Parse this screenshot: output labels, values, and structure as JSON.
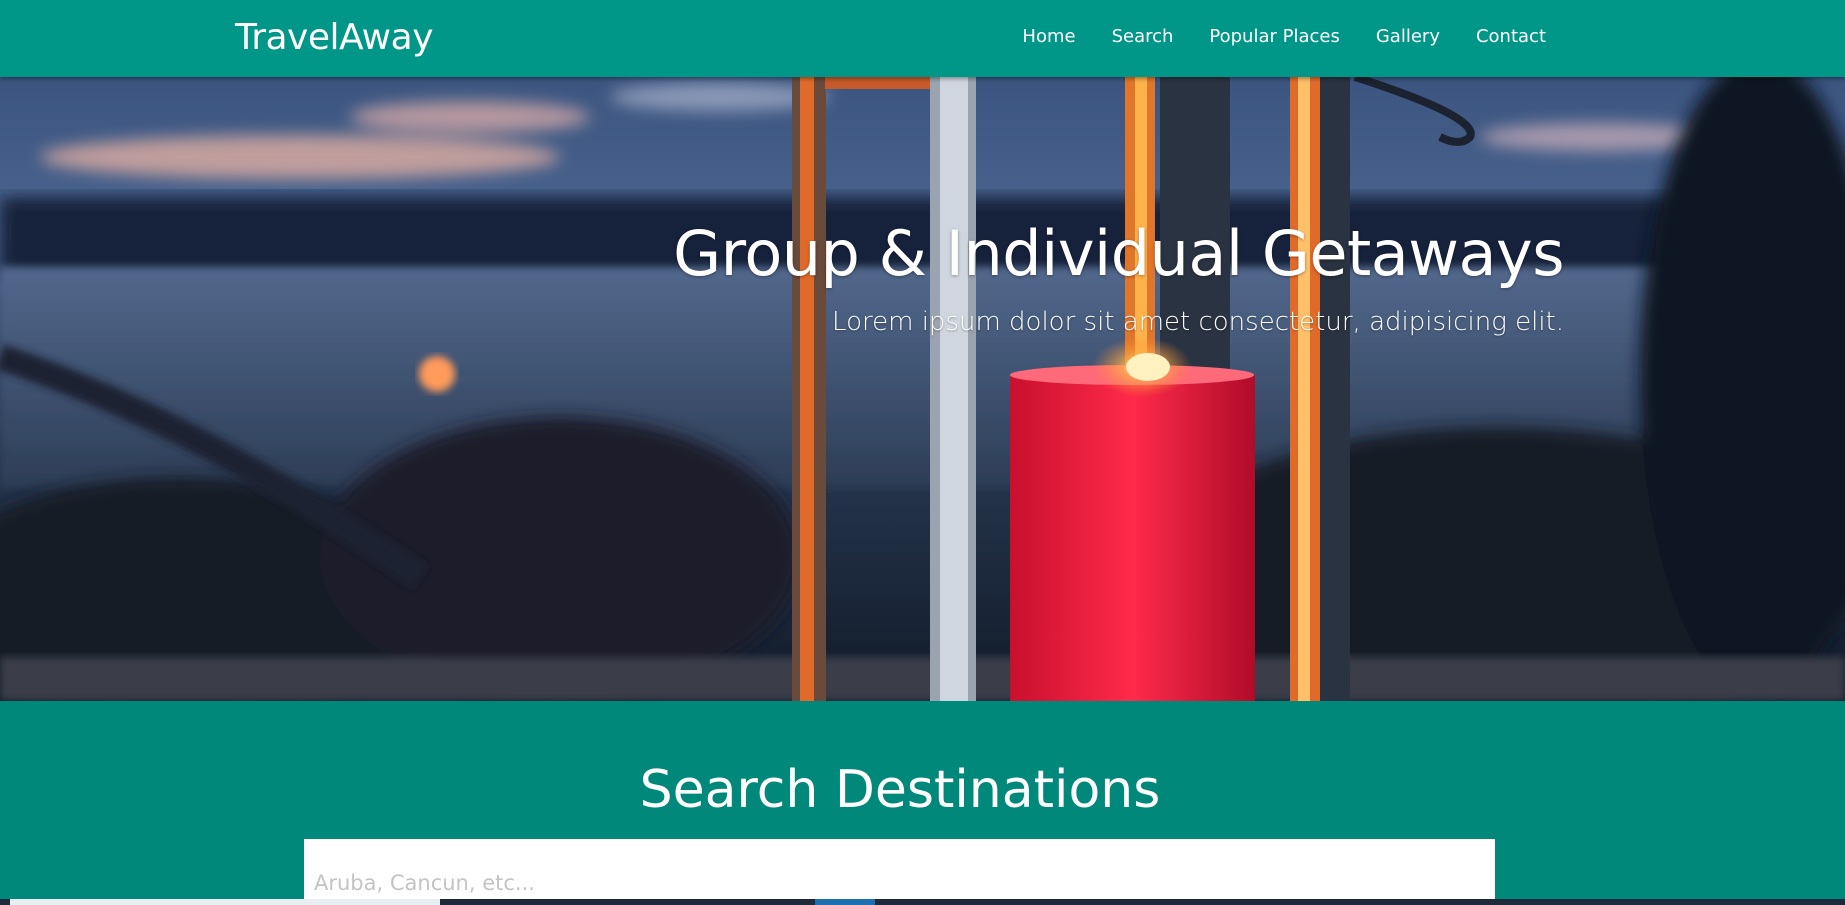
{
  "brand": {
    "name": "TravelAway"
  },
  "nav": {
    "items": [
      {
        "label": "Home"
      },
      {
        "label": "Search"
      },
      {
        "label": "Popular Places"
      },
      {
        "label": "Gallery"
      },
      {
        "label": "Contact"
      }
    ]
  },
  "hero": {
    "title": "Group & Individual Getaways",
    "subtitle": "Lorem ipsum dolor sit amet consectetur, adipisicing elit."
  },
  "search": {
    "heading": "Search Destinations",
    "placeholder": "Aruba, Cancun, etc..."
  },
  "colors": {
    "navbar": "#009688",
    "search_section": "#00897b",
    "text": "#ffffff"
  }
}
